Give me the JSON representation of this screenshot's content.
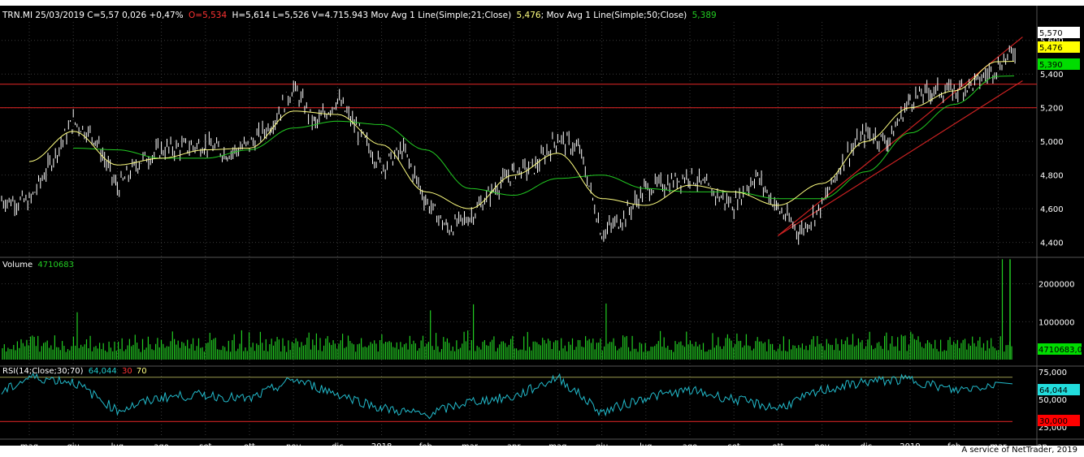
{
  "header": {
    "price_text": "TRN.MI 25/03/2019 C=5,57 0,026 +0,47%",
    "open_text": "O=5,534",
    "hl_text": "H=5,614 L=5,526 V=4.715.943 Mov Avg 1 Line(Simple;21;Close)",
    "ma21_value": "5,476",
    "ma50_label": "Mov Avg 1 Line(Simple;50;Close)",
    "ma50_value": "5,389"
  },
  "volume_header": {
    "label": "Volume",
    "value": "4710683"
  },
  "rsi_header": {
    "label": "RSI(14;Close;30;70)",
    "value": "64,044",
    "low": "30",
    "high": "70"
  },
  "price_badges": {
    "close": "5,570",
    "ma21": "5,476",
    "ma50": "5,390"
  },
  "volume_badge": "4710683,0",
  "rsi_badges": {
    "value": "64,044",
    "low": "30,000"
  },
  "footer": "A service of NetTrader, 2019",
  "colors": {
    "background": "#000000",
    "price": "#ffffff",
    "ma21": "#ffff80",
    "ma50": "#22cc22",
    "volume": "#22cc22",
    "rsi": "#22bbcc",
    "lines": "#cc2222",
    "grid": "#3a3a3a"
  },
  "chart_data": [
    {
      "type": "candlestick",
      "title": "TRN.MI",
      "ylim": [
        4.35,
        5.7
      ],
      "yticks": [
        "5,600",
        "5,400",
        "5,200",
        "5,000",
        "4,800",
        "4,600",
        "4,400"
      ],
      "xticks": [
        "mag",
        "giu",
        "lug",
        "ago",
        "set",
        "ott",
        "nov",
        "dic",
        "2018",
        "feb",
        "mar",
        "apr",
        "mag",
        "giu",
        "lug",
        "ago",
        "set",
        "ott",
        "nov",
        "dic",
        "2019",
        "feb",
        "mar",
        "ap"
      ],
      "horizontal_levels": [
        5.34,
        5.2
      ],
      "channel_lines": [
        {
          "from": [
            "ott 2018",
            4.44
          ],
          "to": [
            "mar 2019",
            5.62
          ]
        },
        {
          "from": [
            "ott 2018",
            4.44
          ],
          "to": [
            "mar 2019",
            5.36
          ]
        }
      ],
      "close_series": [
        {
          "x": "mag 2017",
          "y": 4.64
        },
        {
          "x": "giu 2017",
          "y": 5.12
        },
        {
          "x": "giu 2017",
          "y": 5.02
        },
        {
          "x": "lug 2017",
          "y": 4.72
        },
        {
          "x": "lug 2017",
          "y": 4.88
        },
        {
          "x": "ago 2017",
          "y": 4.95
        },
        {
          "x": "set 2017",
          "y": 4.98
        },
        {
          "x": "set 2017",
          "y": 4.93
        },
        {
          "x": "ott 2017",
          "y": 4.98
        },
        {
          "x": "ott 2017",
          "y": 5.1
        },
        {
          "x": "nov 2017",
          "y": 5.32
        },
        {
          "x": "nov 2017",
          "y": 5.1
        },
        {
          "x": "dic 2017",
          "y": 5.25
        },
        {
          "x": "dic 2017",
          "y": 5.05
        },
        {
          "x": "2018",
          "y": 4.85
        },
        {
          "x": "2018",
          "y": 4.95
        },
        {
          "x": "feb 2018",
          "y": 4.65
        },
        {
          "x": "feb 2018",
          "y": 4.48
        },
        {
          "x": "mar 2018",
          "y": 4.55
        },
        {
          "x": "mar 2018",
          "y": 4.7
        },
        {
          "x": "apr 2018",
          "y": 4.82
        },
        {
          "x": "apr 2018",
          "y": 4.85
        },
        {
          "x": "mag 2018",
          "y": 5.02
        },
        {
          "x": "mag 2018",
          "y": 4.95
        },
        {
          "x": "giu 2018",
          "y": 4.45
        },
        {
          "x": "giu 2018",
          "y": 4.55
        },
        {
          "x": "lug 2018",
          "y": 4.72
        },
        {
          "x": "lug 2018",
          "y": 4.75
        },
        {
          "x": "ago 2018",
          "y": 4.8
        },
        {
          "x": "ago 2018",
          "y": 4.7
        },
        {
          "x": "set 2018",
          "y": 4.62
        },
        {
          "x": "set 2018",
          "y": 4.8
        },
        {
          "x": "ott 2018",
          "y": 4.6
        },
        {
          "x": "ott 2018",
          "y": 4.46
        },
        {
          "x": "nov 2018",
          "y": 4.62
        },
        {
          "x": "nov 2018",
          "y": 4.9
        },
        {
          "x": "dic 2018",
          "y": 5.05
        },
        {
          "x": "dic 2018",
          "y": 5.0
        },
        {
          "x": "2019",
          "y": 5.25
        },
        {
          "x": "2019",
          "y": 5.3
        },
        {
          "x": "feb 2019",
          "y": 5.3
        },
        {
          "x": "feb 2019",
          "y": 5.35
        },
        {
          "x": "mar 2019",
          "y": 5.45
        },
        {
          "x": "mar 2019",
          "y": 5.57
        }
      ],
      "ma21_series": [
        {
          "x": "mag 2017",
          "y": 4.88
        },
        {
          "x": "giu 2017",
          "y": 5.06
        },
        {
          "x": "lug 2017",
          "y": 4.86
        },
        {
          "x": "ago 2017",
          "y": 4.9
        },
        {
          "x": "set 2017",
          "y": 4.95
        },
        {
          "x": "ott 2017",
          "y": 4.96
        },
        {
          "x": "nov 2017",
          "y": 5.18
        },
        {
          "x": "dic 2017",
          "y": 5.16
        },
        {
          "x": "2018",
          "y": 4.98
        },
        {
          "x": "feb 2018",
          "y": 4.7
        },
        {
          "x": "mar 2018",
          "y": 4.6
        },
        {
          "x": "apr 2018",
          "y": 4.8
        },
        {
          "x": "mag 2018",
          "y": 4.93
        },
        {
          "x": "giu 2018",
          "y": 4.66
        },
        {
          "x": "lug 2018",
          "y": 4.62
        },
        {
          "x": "ago 2018",
          "y": 4.74
        },
        {
          "x": "set 2018",
          "y": 4.7
        },
        {
          "x": "ott 2018",
          "y": 4.62
        },
        {
          "x": "nov 2018",
          "y": 4.75
        },
        {
          "x": "dic 2018",
          "y": 5.0
        },
        {
          "x": "2019",
          "y": 5.2
        },
        {
          "x": "feb 2019",
          "y": 5.3
        },
        {
          "x": "mar 2019",
          "y": 5.476
        }
      ],
      "ma50_series": [
        {
          "x": "giu 2017",
          "y": 4.96
        },
        {
          "x": "lug 2017",
          "y": 4.95
        },
        {
          "x": "ago 2017",
          "y": 4.9
        },
        {
          "x": "set 2017",
          "y": 4.9
        },
        {
          "x": "ott 2017",
          "y": 4.95
        },
        {
          "x": "nov 2017",
          "y": 5.08
        },
        {
          "x": "dic 2017",
          "y": 5.12
        },
        {
          "x": "2018",
          "y": 5.1
        },
        {
          "x": "feb 2018",
          "y": 4.95
        },
        {
          "x": "mar 2018",
          "y": 4.72
        },
        {
          "x": "apr 2018",
          "y": 4.68
        },
        {
          "x": "mag 2018",
          "y": 4.78
        },
        {
          "x": "giu 2018",
          "y": 4.8
        },
        {
          "x": "lug 2018",
          "y": 4.72
        },
        {
          "x": "ago 2018",
          "y": 4.7
        },
        {
          "x": "set 2018",
          "y": 4.7
        },
        {
          "x": "ott 2018",
          "y": 4.66
        },
        {
          "x": "nov 2018",
          "y": 4.66
        },
        {
          "x": "dic 2018",
          "y": 4.82
        },
        {
          "x": "2019",
          "y": 5.05
        },
        {
          "x": "feb 2019",
          "y": 5.22
        },
        {
          "x": "mar 2019",
          "y": 5.389
        }
      ]
    },
    {
      "type": "bar",
      "title": "Volume",
      "ylim": [
        0,
        2700000
      ],
      "yticks": [
        "2000000",
        "1000000"
      ],
      "spikes": [
        {
          "x": "giu 2017",
          "value": 1250000
        },
        {
          "x": "feb 2018",
          "value": 1300000
        },
        {
          "x": "mar 2018",
          "value": 1460000
        },
        {
          "x": "giu 2018",
          "value": 1480000
        },
        {
          "x": "mar 2019",
          "value": 2650000
        }
      ],
      "typical_range": [
        200000,
        800000
      ]
    },
    {
      "type": "line",
      "title": "RSI(14;Close;30;70)",
      "ylim": [
        20,
        80
      ],
      "yticks": [
        "75,000",
        "50,000",
        "25,000"
      ],
      "levels": [
        70,
        30
      ],
      "series": [
        {
          "x": "mag 2017",
          "y": 70
        },
        {
          "x": "giu 2017",
          "y": 66
        },
        {
          "x": "lug 2017",
          "y": 40
        },
        {
          "x": "ago 2017",
          "y": 52
        },
        {
          "x": "set 2017",
          "y": 54
        },
        {
          "x": "ott 2017",
          "y": 50
        },
        {
          "x": "nov 2017",
          "y": 68
        },
        {
          "x": "dic 2017",
          "y": 55
        },
        {
          "x": "2018",
          "y": 42
        },
        {
          "x": "feb 2018",
          "y": 36
        },
        {
          "x": "mar 2018",
          "y": 48
        },
        {
          "x": "apr 2018",
          "y": 52
        },
        {
          "x": "mag 2018",
          "y": 70
        },
        {
          "x": "giu 2018",
          "y": 38
        },
        {
          "x": "lug 2018",
          "y": 52
        },
        {
          "x": "ago 2018",
          "y": 58
        },
        {
          "x": "set 2018",
          "y": 50
        },
        {
          "x": "ott 2018",
          "y": 42
        },
        {
          "x": "nov 2018",
          "y": 58
        },
        {
          "x": "dic 2018",
          "y": 66
        },
        {
          "x": "2019",
          "y": 68
        },
        {
          "x": "feb 2019",
          "y": 58
        },
        {
          "x": "mar 2019",
          "y": 64.044
        }
      ]
    }
  ]
}
